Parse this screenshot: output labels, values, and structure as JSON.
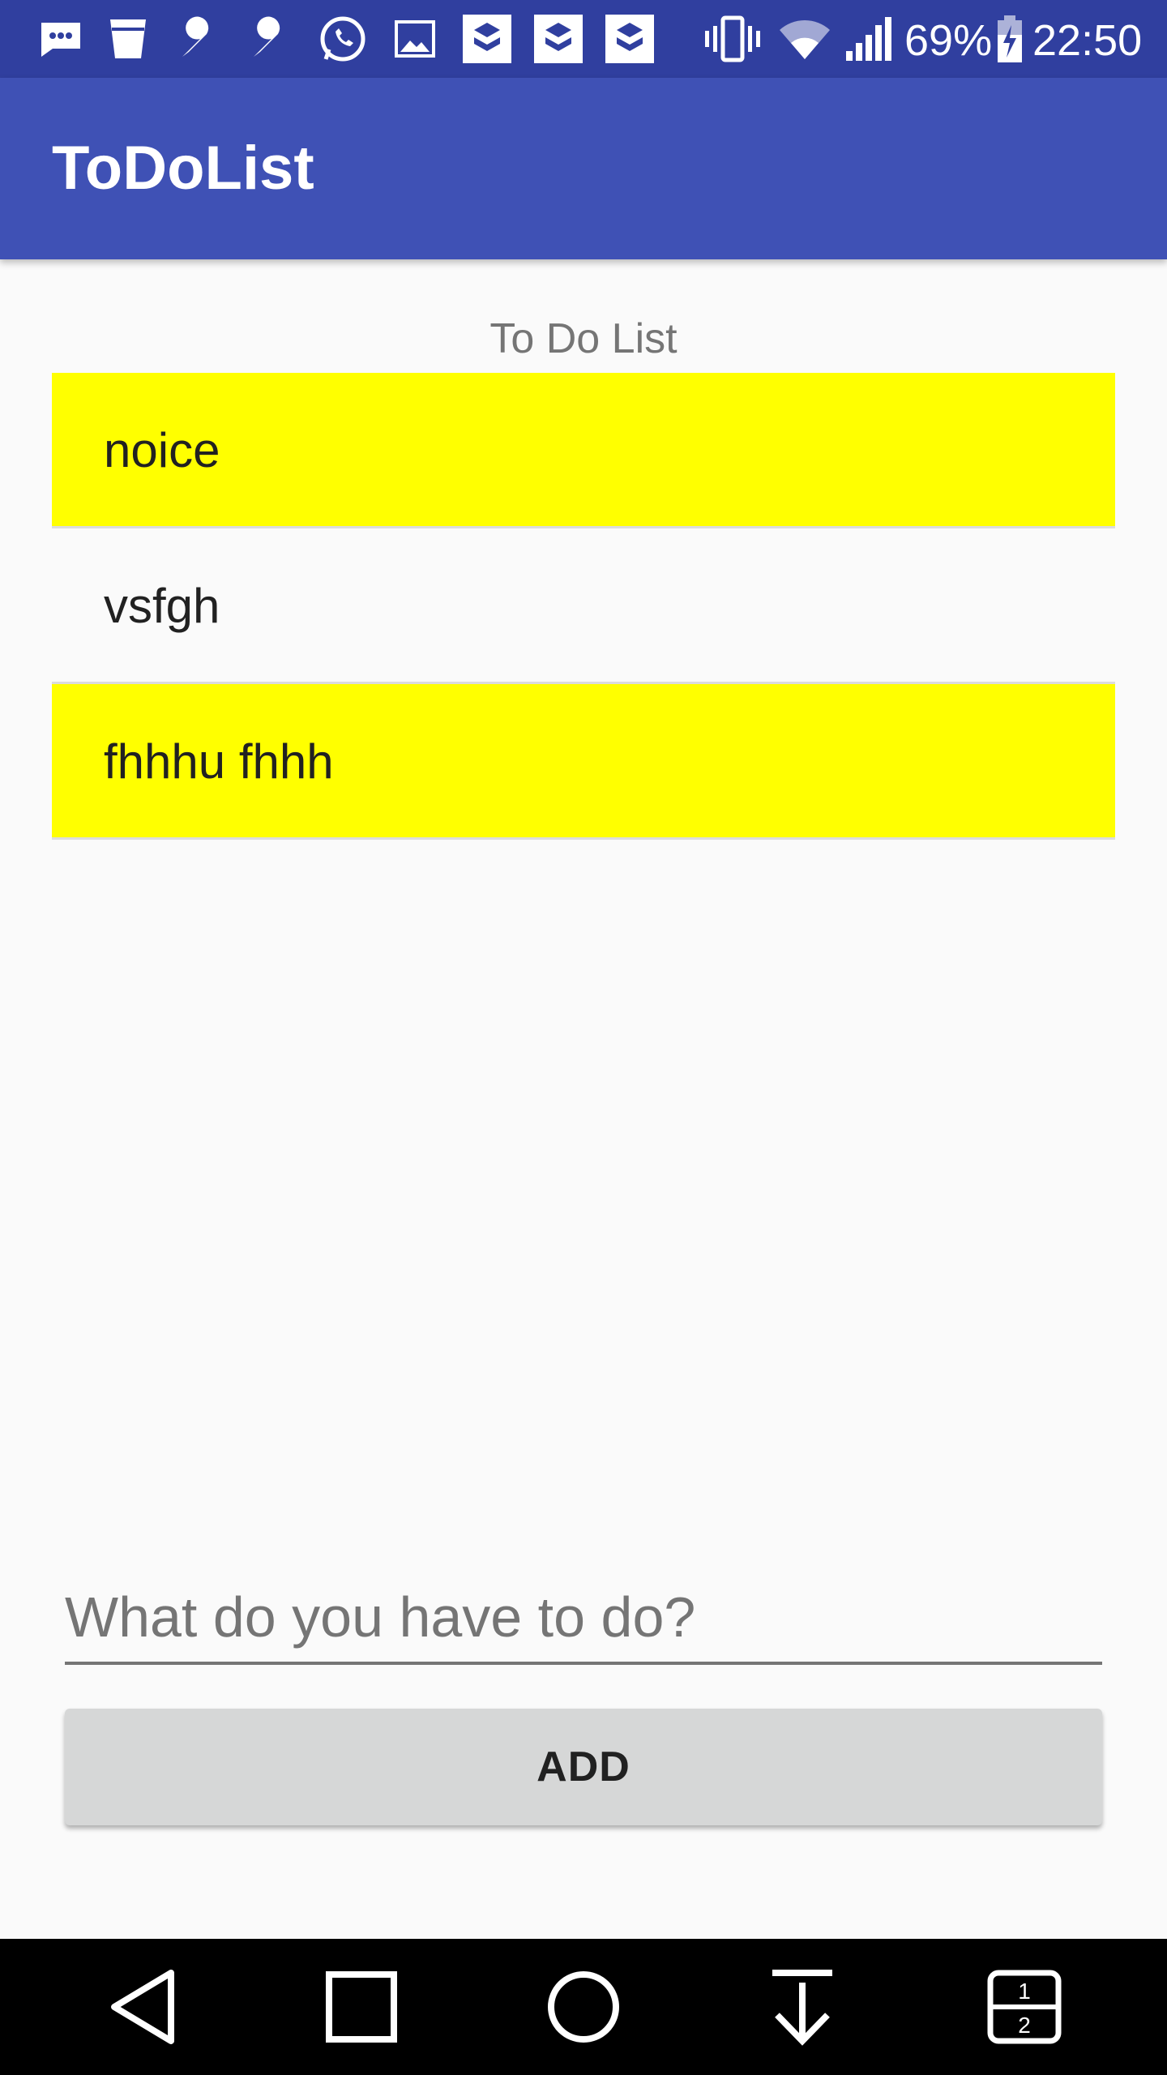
{
  "status_bar": {
    "battery_percent": "69%",
    "time": "22:50",
    "icons": [
      "message-icon",
      "cup-icon",
      "wrench-icon",
      "wrench-icon",
      "whatsapp-icon",
      "image-icon",
      "app-icon",
      "app-icon",
      "app-icon",
      "vibrate-icon",
      "wifi-icon",
      "signal-icon",
      "battery-charging-icon"
    ]
  },
  "app_bar": {
    "title": "ToDoList"
  },
  "main": {
    "list_header": "To Do List",
    "items": [
      {
        "label": "noice",
        "highlighted": true
      },
      {
        "label": "vsfgh",
        "highlighted": false
      },
      {
        "label": "fhhhu fhhh",
        "highlighted": true
      }
    ],
    "input": {
      "placeholder": "What do you have to do?",
      "value": ""
    },
    "add_button_label": "ADD"
  },
  "nav_bar": {
    "buttons": [
      "back-icon",
      "recents-icon",
      "home-icon",
      "notifications-down-icon",
      "dual-window-icon"
    ]
  },
  "colors": {
    "status_bar": "#303f9f",
    "app_bar": "#3f51b5",
    "highlight": "#ffff00",
    "button": "#d6d7d7"
  }
}
